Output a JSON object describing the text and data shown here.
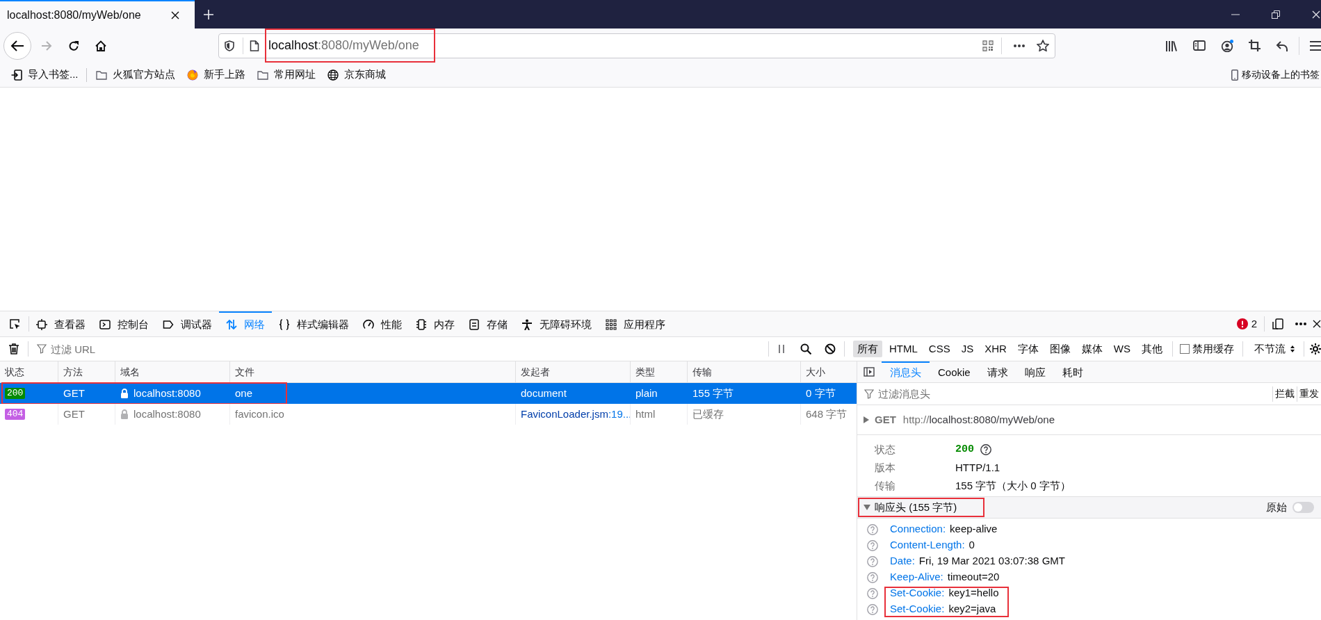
{
  "browser_tabs": [
    {
      "title": "localhost:8080/myWeb/one",
      "selected": true
    }
  ],
  "address_bar": {
    "host": "localhost",
    "path": ":8080/myWeb/one",
    "highlighted": true
  },
  "bookmarks": [
    {
      "label": "导入书签...",
      "kind": "import"
    },
    {
      "label": "火狐官方站点",
      "kind": "folder"
    },
    {
      "label": "新手上路",
      "kind": "logo"
    },
    {
      "label": "常用网址",
      "kind": "folder"
    },
    {
      "label": "京东商城",
      "kind": "globe"
    }
  ],
  "mobile_bookmarks": {
    "label": "移动设备上的书签"
  },
  "devtools": {
    "tabs": [
      {
        "label": "查看器",
        "selected": false
      },
      {
        "label": "控制台",
        "selected": false
      },
      {
        "label": "调试器",
        "selected": false
      },
      {
        "label": "网络",
        "selected": true
      },
      {
        "label": "样式编辑器",
        "selected": false
      },
      {
        "label": "性能",
        "selected": false
      },
      {
        "label": "内存",
        "selected": false
      },
      {
        "label": "存储",
        "selected": false
      },
      {
        "label": "无障碍环境",
        "selected": false
      },
      {
        "label": "应用程序",
        "selected": false
      }
    ],
    "error_count": "2"
  },
  "network": {
    "url_filter": {
      "placeholder": "过滤 URL"
    },
    "type_filters": [
      {
        "label": "所有",
        "selected": true
      },
      {
        "label": "HTML",
        "selected": false
      },
      {
        "label": "CSS",
        "selected": false
      },
      {
        "label": "JS",
        "selected": false
      },
      {
        "label": "XHR",
        "selected": false
      },
      {
        "label": "字体",
        "selected": false
      },
      {
        "label": "图像",
        "selected": false
      },
      {
        "label": "媒体",
        "selected": false
      },
      {
        "label": "WS",
        "selected": false
      },
      {
        "label": "其他",
        "selected": false
      }
    ],
    "disable_cache": {
      "label": "禁用缓存",
      "checked": false
    },
    "throttling": "不节流",
    "columns": [
      "状态",
      "方法",
      "域名",
      "文件",
      "发起者",
      "类型",
      "传输",
      "大小"
    ],
    "requests": [
      {
        "status": "200",
        "color": "#058b00",
        "method": "GET",
        "domain": "localhost:8080",
        "file": "one",
        "initiator": "document",
        "type": "plain",
        "transferred": "155 字节",
        "size": "0 字节",
        "selected": true,
        "from_cache": false,
        "highlighted": true
      },
      {
        "status": "404",
        "color": "#c45fe4",
        "method": "GET",
        "domain": "localhost:8080",
        "file": "favicon.ico",
        "initiator": "FaviconLoader.jsm",
        "initiator_line": ":19...",
        "type": "html",
        "transferred": "已缓存",
        "size": "648 字节",
        "selected": false,
        "from_cache": true,
        "highlighted": false
      }
    ]
  },
  "details": {
    "tabs": [
      {
        "label": "消息头",
        "selected": true
      },
      {
        "label": "Cookie",
        "selected": false
      },
      {
        "label": "请求",
        "selected": false
      },
      {
        "label": "响应",
        "selected": false
      },
      {
        "label": "耗时",
        "selected": false
      }
    ],
    "filter": {
      "placeholder": "过滤消息头"
    },
    "actions": [
      "拦截",
      "重发"
    ],
    "request_line": {
      "method": "GET",
      "scheme": "http://",
      "address": "localhost:8080/myWeb/one",
      "expanded": false
    },
    "summary": [
      {
        "label": "状态",
        "value": "200",
        "kind": "status"
      },
      {
        "label": "版本",
        "value": "HTTP/1.1",
        "kind": "text"
      },
      {
        "label": "传输",
        "value": "155 字节（大小 0 字节）",
        "kind": "text"
      }
    ],
    "response_headers": {
      "title": "响应头 (155 字节)",
      "expanded": true,
      "highlighted": true,
      "raw": {
        "label": "原始",
        "on": false
      },
      "headers": [
        {
          "name": "Connection:",
          "value": "keep-alive",
          "highlighted": false
        },
        {
          "name": "Content-Length:",
          "value": "0",
          "highlighted": false
        },
        {
          "name": "Date:",
          "value": "Fri, 19 Mar 2021 03:07:38 GMT",
          "highlighted": false
        },
        {
          "name": "Keep-Alive:",
          "value": "timeout=20",
          "highlighted": false
        },
        {
          "name": "Set-Cookie:",
          "value": "key1=hello",
          "highlighted": true
        },
        {
          "name": "Set-Cookie:",
          "value": "key2=java",
          "highlighted": true
        }
      ]
    }
  }
}
